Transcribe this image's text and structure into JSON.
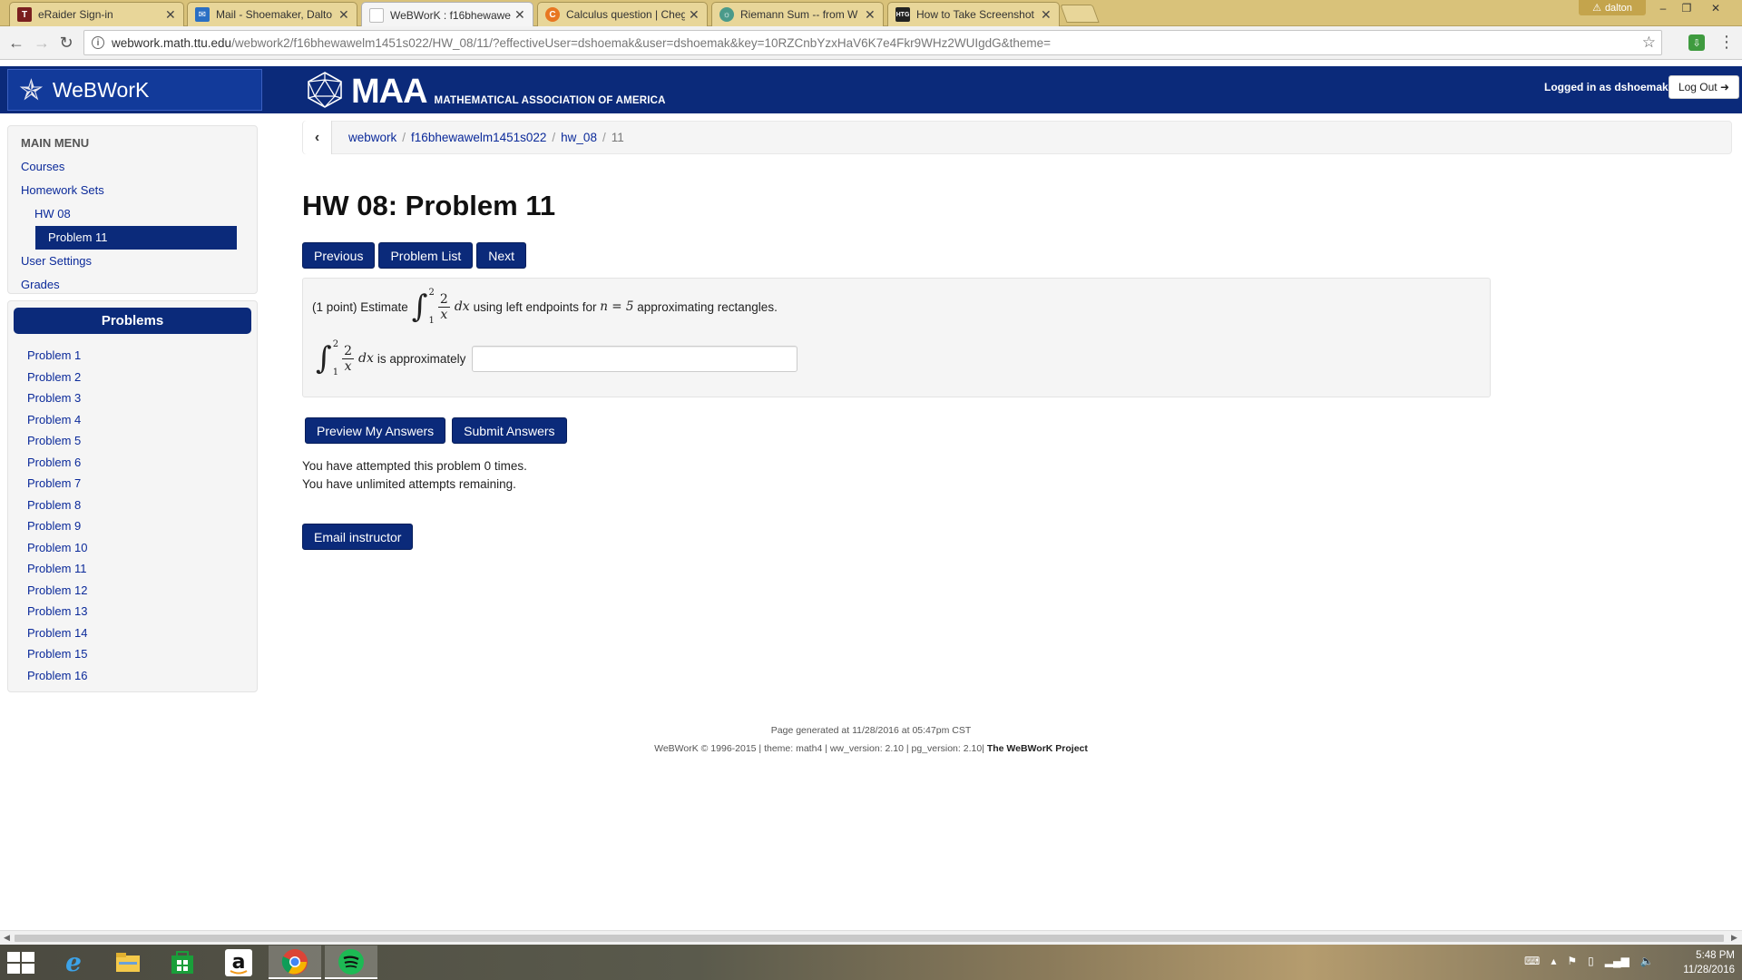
{
  "browser": {
    "tabs": [
      {
        "label": "eRaider Sign-in",
        "icon": "texas-tech-favicon",
        "icon_color": "#7a1f1f",
        "active": false
      },
      {
        "label": "Mail - Shoemaker, Dalto",
        "icon": "mail-favicon",
        "icon_color": "#2a6fc4",
        "active": false
      },
      {
        "label": "WeBWorK : f16bhewawe",
        "icon": "page-favicon",
        "icon_color": "#cccccc",
        "active": true
      },
      {
        "label": "Calculus question | Cheg",
        "icon": "chegg-favicon",
        "icon_color": "#e87722",
        "active": false
      },
      {
        "label": "Riemann Sum -- from W",
        "icon": "wolfram-favicon",
        "icon_color": "#4a9a8a",
        "active": false
      },
      {
        "label": "How to Take Screenshot",
        "icon": "htg-favicon",
        "icon_color": "#222222",
        "active": false
      }
    ],
    "user_name": "dalton",
    "url_host": "webwork.math.ttu.edu",
    "url_path": "/webwork2/f16bhewawelm1451s022/HW_08/11/?effectiveUser=dshoemak&user=dshoemak&key=10RZCnbYzxHaV6K7e4Fkr9WHz2WUIgdG&theme="
  },
  "header": {
    "app_name": "WeBWorK",
    "maa_big": "MAA",
    "maa_small": "MATHEMATICAL ASSOCIATION OF AMERICA",
    "logged_in_text": "Logged in as dshoemak.",
    "logout_label": "Log Out",
    "bar_color": "#0b2a7a"
  },
  "sidebar": {
    "main_menu_title": "MAIN MENU",
    "links": {
      "courses": "Courses",
      "homework_sets": "Homework Sets",
      "hw08": "HW 08",
      "problem11": "Problem 11",
      "user_settings": "User Settings",
      "grades": "Grades"
    },
    "problems_title": "Problems",
    "problems": [
      "Problem 1",
      "Problem 2",
      "Problem 3",
      "Problem 4",
      "Problem 5",
      "Problem 6",
      "Problem 7",
      "Problem 8",
      "Problem 9",
      "Problem 10",
      "Problem 11",
      "Problem 12",
      "Problem 13",
      "Problem 14",
      "Problem 15",
      "Problem 16"
    ]
  },
  "breadcrumb": {
    "items": [
      "webwork",
      "f16bhewawelm1451s022",
      "hw_08"
    ],
    "current": "11",
    "separator": "/"
  },
  "main": {
    "title": "HW 08: Problem 11",
    "nav": {
      "previous": "Previous",
      "problem_list": "Problem List",
      "next": "Next"
    },
    "problem": {
      "points_prefix": "(1 point) Estimate",
      "integral": {
        "lower": "1",
        "upper": "2",
        "numerator": "2",
        "denominator": "x",
        "differential": "dx"
      },
      "suffix_1": "using left endpoints for",
      "n_expr": "n = 5",
      "suffix_2": "approximating rectangles.",
      "answer_label": "is approximately",
      "answer_value": ""
    },
    "buttons": {
      "preview": "Preview My Answers",
      "submit": "Submit Answers",
      "email": "Email instructor"
    },
    "attempts_line1": "You have attempted this problem 0 times.",
    "attempts_line2": "You have unlimited attempts remaining."
  },
  "footer": {
    "generated": "Page generated at 11/28/2016 at 05:47pm CST",
    "copyright": "WeBWorK © 1996-2015 | theme: math4 | ww_version: 2.10 | pg_version: 2.10|",
    "project": "The WeBWorK Project"
  },
  "taskbar": {
    "apps": [
      "windows-start",
      "internet-explorer",
      "file-explorer",
      "store",
      "amazon",
      "chrome",
      "spotify"
    ],
    "time": "5:48 PM",
    "date": "11/28/2016"
  }
}
